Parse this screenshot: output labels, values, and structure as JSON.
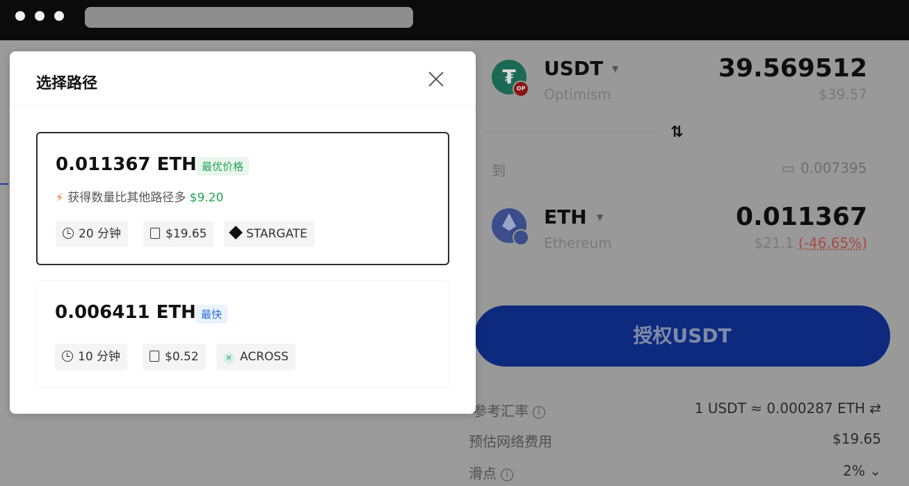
{
  "modal": {
    "title": "选择路径",
    "routes": [
      {
        "amount": "0.011367 ETH",
        "tag": "最优价格",
        "bonus_text": "获得数量比其他路径多",
        "bonus_value": "$9.20",
        "time": "20 分钟",
        "fee": "$19.65",
        "provider": "STARGATE"
      },
      {
        "amount": "0.006411 ETH",
        "tag": "最快",
        "time": "10 分钟",
        "fee": "$0.52",
        "provider": "ACROSS"
      }
    ]
  },
  "background": {
    "from": {
      "token": "USDT",
      "network": "Optimism",
      "amount": "39.569512",
      "usd": "$39.57"
    },
    "to_label": "到",
    "balance": "0.007395",
    "to": {
      "token": "ETH",
      "network": "Ethereum",
      "amount": "0.011367",
      "usd": "$21.1",
      "change": "(-46.65%)"
    },
    "approve_button": "授权USDT",
    "rate_label": "参考汇率",
    "rate_value": "1 USDT ≈ 0.000287 ETH",
    "network_fee_label": "预估网络费用",
    "network_fee_value": "$19.65",
    "slippage_label": "滑点",
    "slippage_value": "2%"
  },
  "colors": {
    "best_tag": "#22a355",
    "fast_tag": "#2a6fd6",
    "approve_button": "#0d2a7e"
  }
}
